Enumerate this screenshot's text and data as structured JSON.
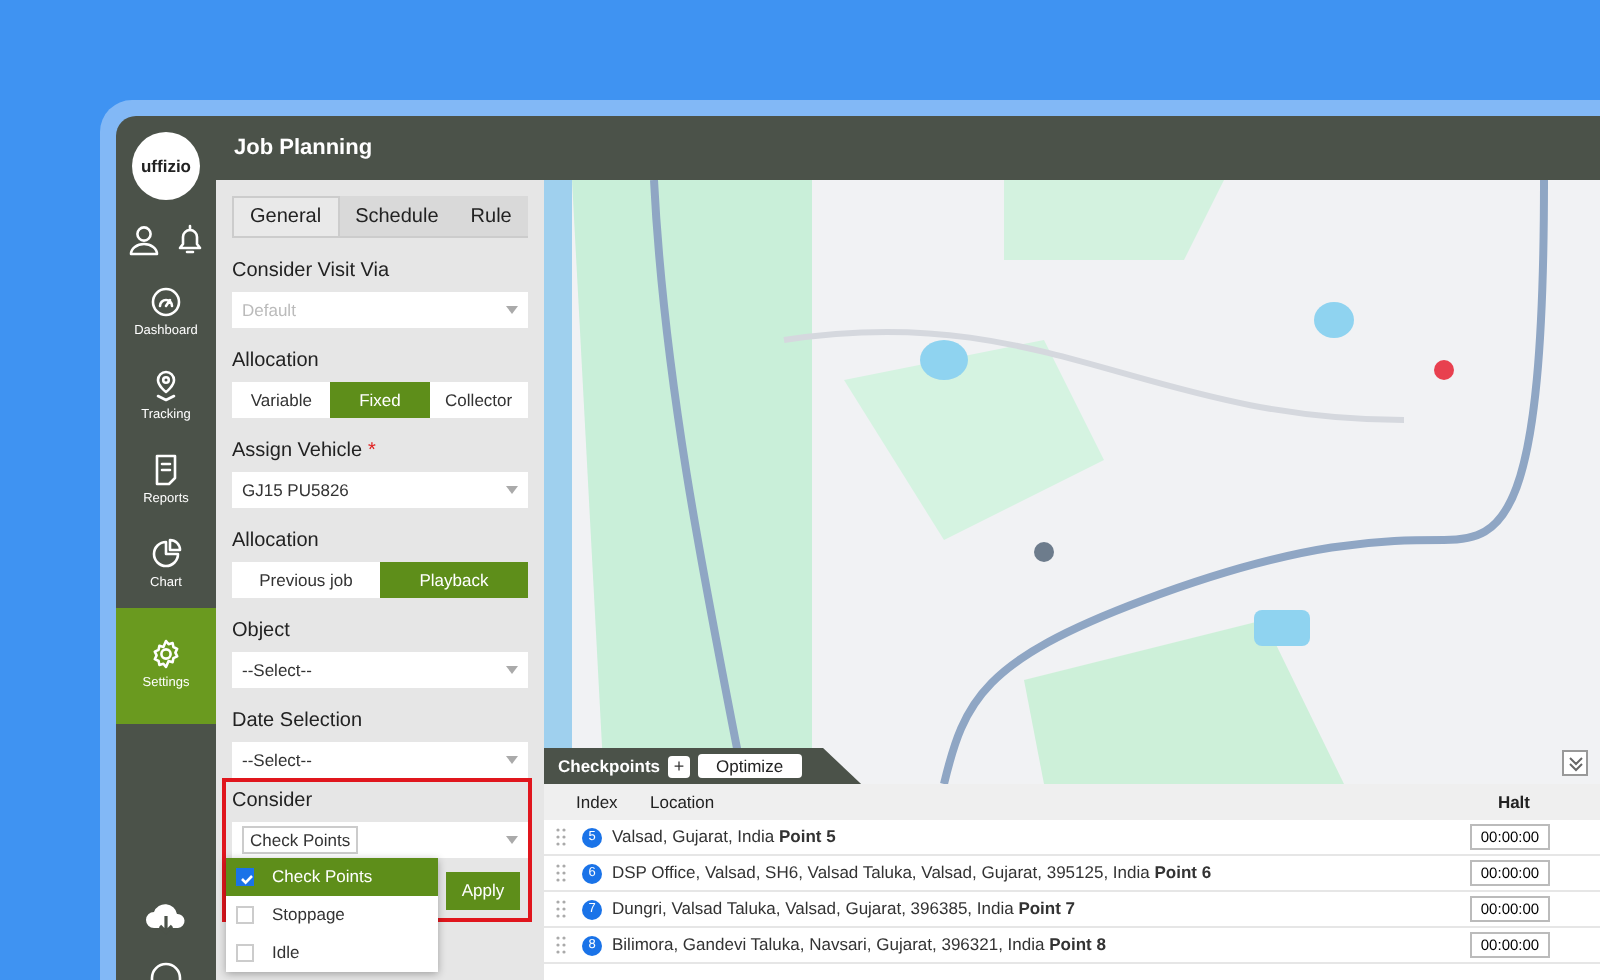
{
  "header": {
    "title": "Job Planning"
  },
  "sidebar": {
    "logo": "uffizio",
    "items": [
      {
        "label": "Dashboard",
        "kind": "dashboard",
        "selected": false
      },
      {
        "label": "Tracking",
        "kind": "tracking",
        "selected": false
      },
      {
        "label": "Reports",
        "kind": "reports",
        "selected": false
      },
      {
        "label": "Chart",
        "kind": "chart",
        "selected": false
      },
      {
        "label": "Settings",
        "kind": "settings",
        "selected": true
      }
    ]
  },
  "tabs": [
    {
      "label": "General",
      "selected": true
    },
    {
      "label": "Schedule",
      "selected": false
    },
    {
      "label": "Rule",
      "selected": false
    }
  ],
  "fields": [
    {
      "kind": "select",
      "label": "Consider Visit Via",
      "placeholder": "Default"
    },
    {
      "kind": "segmented",
      "label": "Allocation",
      "options": [
        {
          "label": "Variable",
          "selected": false
        },
        {
          "label": "Fixed",
          "selected": true
        },
        {
          "label": "Collector",
          "selected": false
        }
      ]
    },
    {
      "kind": "select",
      "label": "Assign Vehicle",
      "required_mark": "*",
      "value": "GJ15 PU5826"
    },
    {
      "kind": "segmented",
      "label": "Allocation",
      "options": [
        {
          "label": "Previous job",
          "selected": false
        },
        {
          "label": "Playback",
          "selected": true
        }
      ]
    },
    {
      "kind": "select",
      "label": "Object",
      "value": "--Select--"
    },
    {
      "kind": "select",
      "label": "Date Selection",
      "value": "--Select--"
    },
    {
      "kind": "multiselect",
      "label": "Consider",
      "chip": "Check Points",
      "highlighted": true,
      "options": [
        {
          "label": "Check Points",
          "checked": true,
          "selected": true
        },
        {
          "label": "Stoppage",
          "checked": false,
          "selected": false
        },
        {
          "label": "Idle",
          "checked": false,
          "selected": false
        }
      ],
      "apply": "Apply"
    }
  ],
  "checkpoints": {
    "title": "Checkpoints",
    "add": "+",
    "optimize": "Optimize",
    "columns": [
      "Index",
      "Location",
      "Halt"
    ],
    "rows": [
      {
        "index": "5",
        "location": "Valsad, Gujarat, India **Point 5**",
        "halt": "00:00:00"
      },
      {
        "index": "6",
        "location": "DSP Office, Valsad, SH6, Valsad Taluka, Valsad, Gujarat, 395125, India **Point 6**",
        "halt": "00:00:00"
      },
      {
        "index": "7",
        "location": "Dungri, Valsad Taluka, Valsad, Gujarat, 396385, India **Point 7**",
        "halt": "00:00:00"
      },
      {
        "index": "8",
        "location": "Bilimora, Gandevi Taluka, Navsari, Gujarat, 396321, India **Point 8**",
        "halt": "00:00:00"
      }
    ]
  }
}
